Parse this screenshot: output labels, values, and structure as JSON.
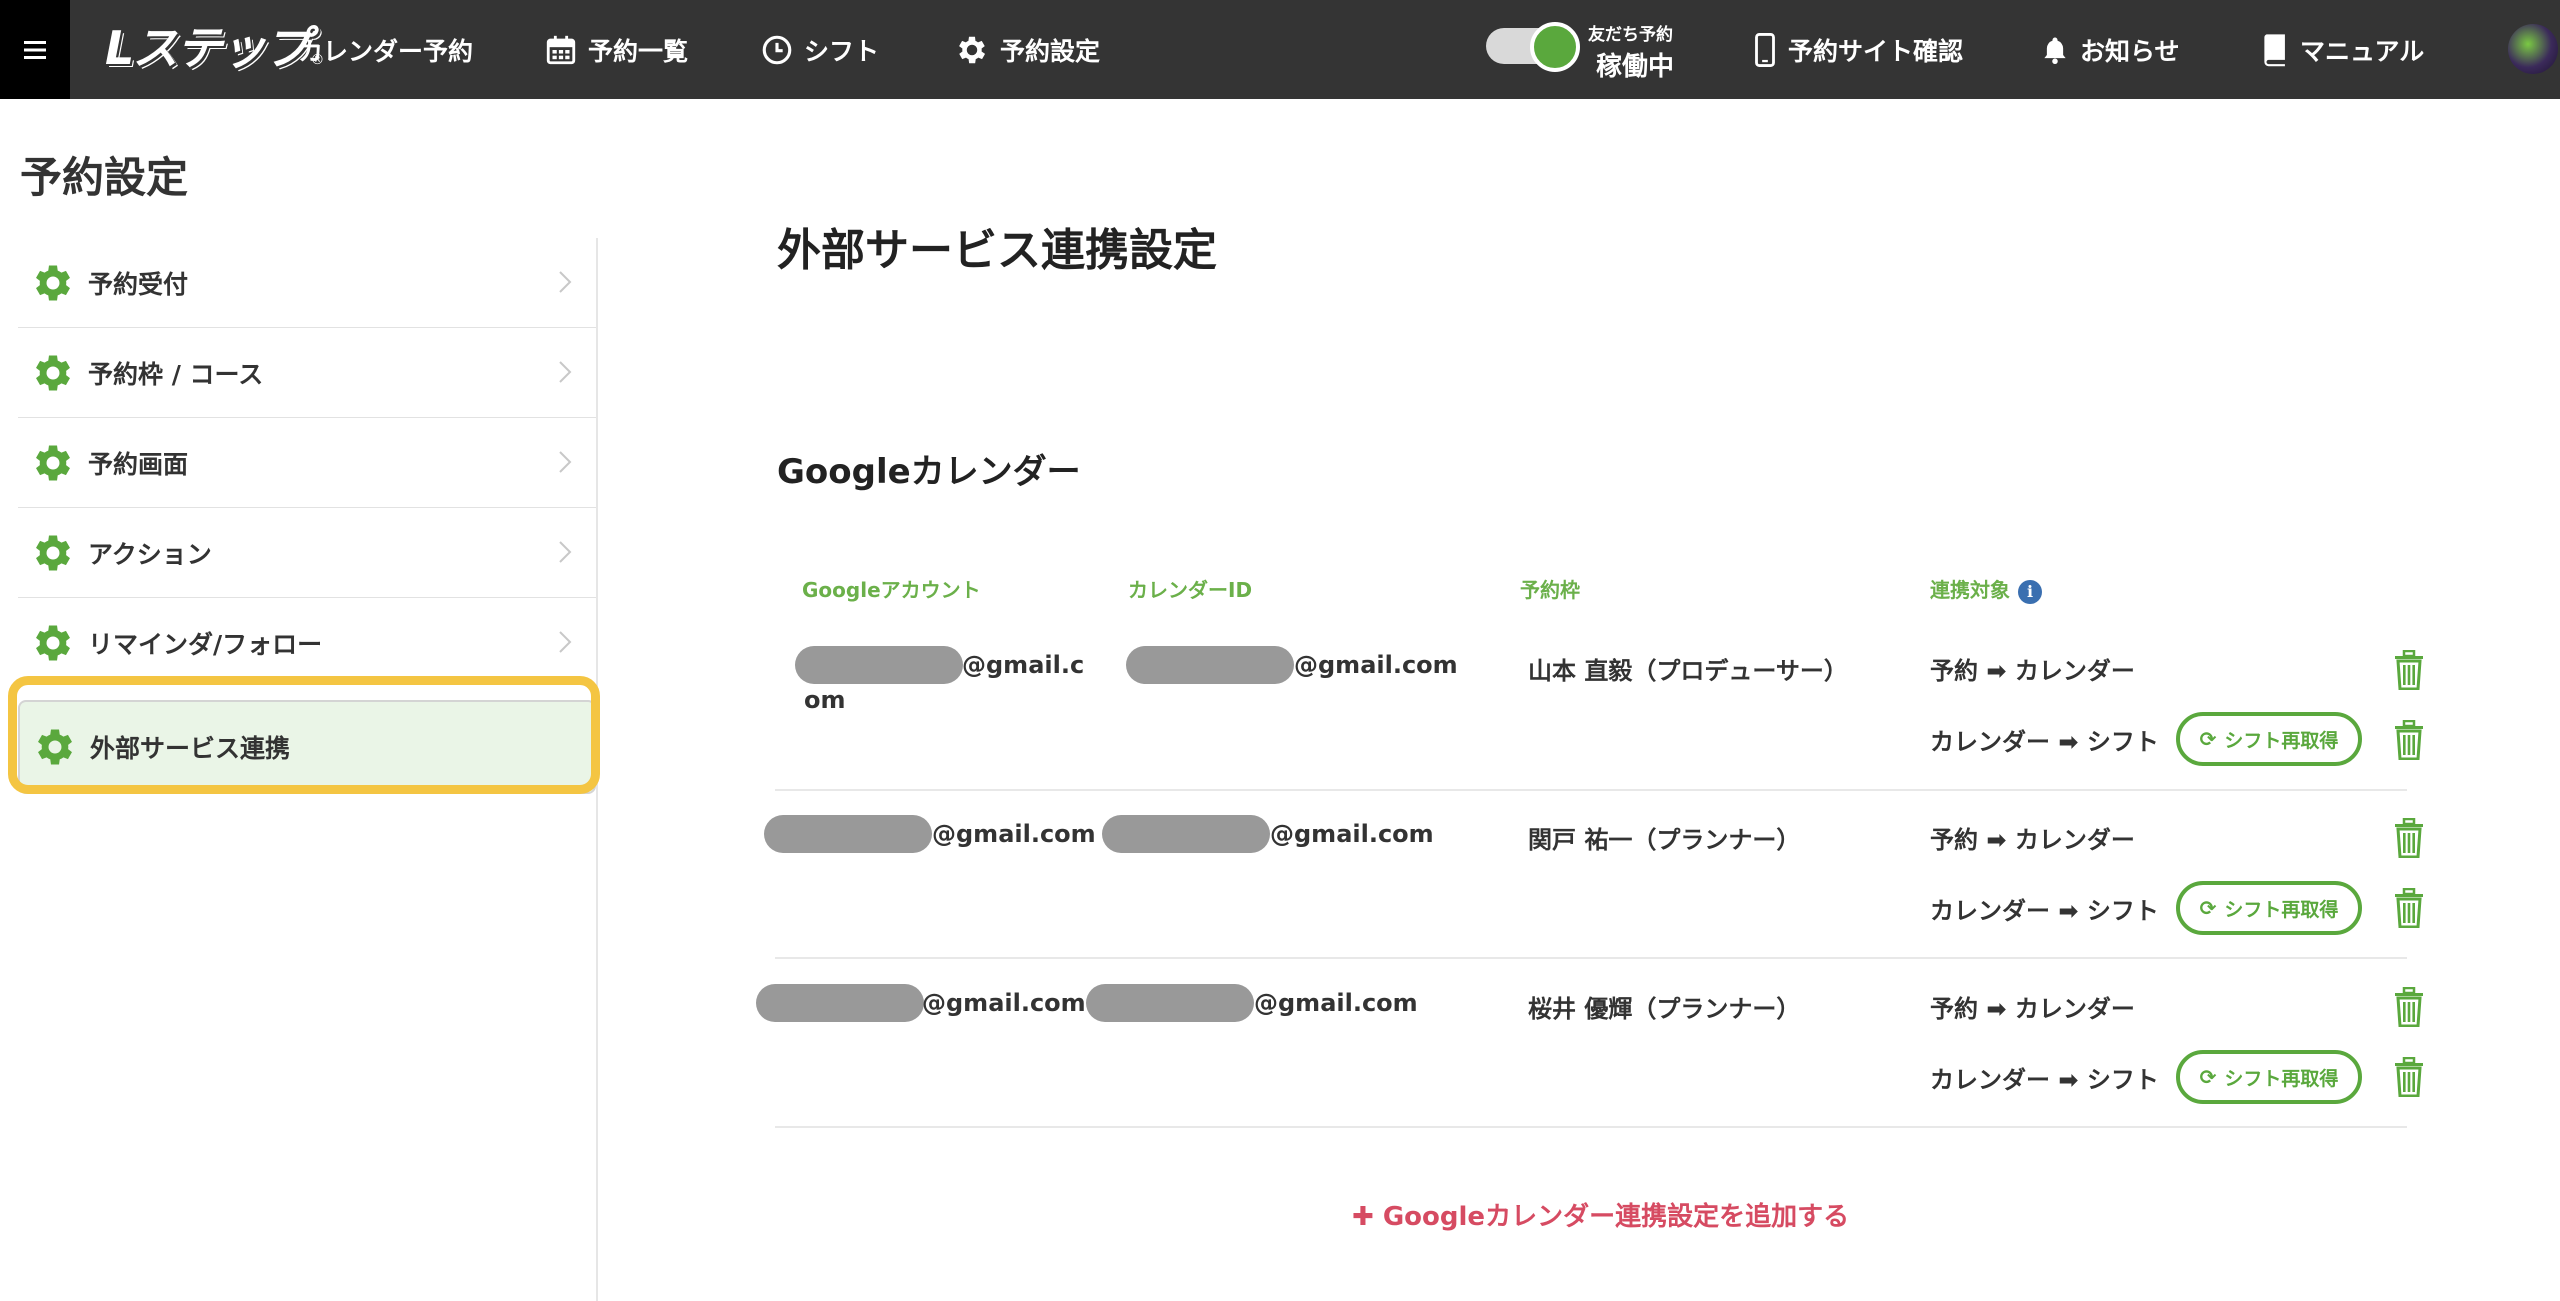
{
  "nav": {
    "logo_text": "Lステップ",
    "app_title": "カレンダー予約",
    "items": [
      {
        "label": "予約一覧",
        "icon": "calendar-icon"
      },
      {
        "label": "シフト",
        "icon": "clock-icon"
      },
      {
        "label": "予約設定",
        "icon": "gear-icon"
      }
    ],
    "status_small": "友だち予約",
    "status_big": "稼働中",
    "right_items": [
      {
        "label": "予約サイト確認",
        "icon": "smartphone-icon"
      },
      {
        "label": "お知らせ",
        "icon": "bell-icon"
      },
      {
        "label": "マニュアル",
        "icon": "book-icon"
      }
    ]
  },
  "sidebar": {
    "title": "予約設定",
    "items": [
      {
        "label": "予約受付"
      },
      {
        "label": "予約枠 / コース"
      },
      {
        "label": "予約画面"
      },
      {
        "label": "アクション"
      },
      {
        "label": "リマインダ/フォロー"
      },
      {
        "label": "外部サービス連携",
        "active": true
      }
    ]
  },
  "main": {
    "title": "外部サービス連携設定",
    "section_title": "Googleカレンダー",
    "columns": {
      "account": "Googleアカウント",
      "calendar_id": "カレンダーID",
      "slot": "予約枠",
      "target": "連携対象"
    },
    "rows": [
      {
        "account_suffix_line1": "@gmail.c",
        "account_suffix_line2": "om",
        "calendar_suffix": "@gmail.com",
        "slot": "山本 直毅（プロデューサー）",
        "target1": "予約 ➡ カレンダー",
        "target2": "カレンダー ➡ シフト",
        "refetch": "シフト再取得"
      },
      {
        "account_suffix": "@gmail.com",
        "calendar_suffix": "@gmail.com",
        "slot": "関戸 祐一（プランナー）",
        "target1": "予約 ➡ カレンダー",
        "target2": "カレンダー ➡ シフト",
        "refetch": "シフト再取得"
      },
      {
        "account_suffix": "@gmail.com",
        "calendar_suffix": "@gmail.com",
        "slot": "桜井 優輝（プランナー）",
        "target1": "予約 ➡ カレンダー",
        "target2": "カレンダー ➡ シフト",
        "refetch": "シフト再取得"
      }
    ],
    "add_link": "Googleカレンダー連携設定を追加する"
  },
  "colors": {
    "accent_green": "#5aa83d",
    "header_green": "#6bb04a",
    "add_link_red": "#d64b62",
    "nav_bg": "#343434",
    "highlight_yellow": "#f4c542"
  }
}
